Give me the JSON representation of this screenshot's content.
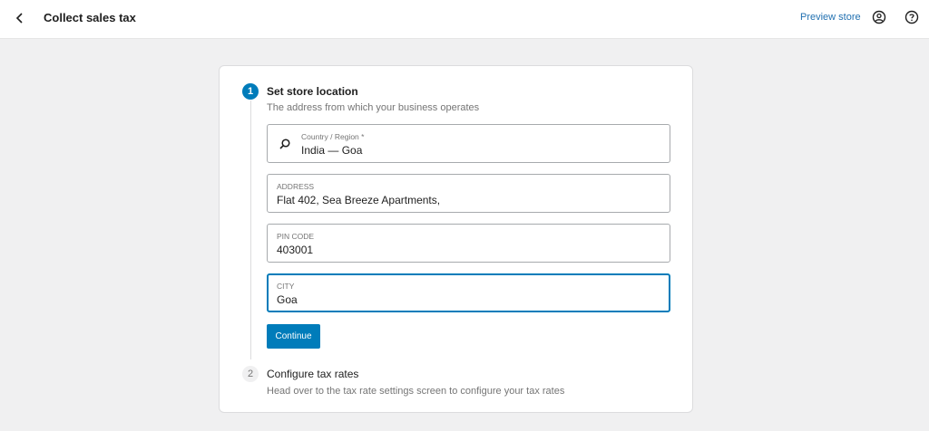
{
  "header": {
    "back_icon": "chevron-left-icon",
    "title": "Collect sales tax",
    "preview_label": "Preview store",
    "account_icon": "user-circle-icon",
    "help_icon": "help-circle-icon"
  },
  "steps": [
    {
      "number": "1",
      "title": "Set store location",
      "description": "The address from which your business operates",
      "state": "active",
      "fields": {
        "country": {
          "label": "Country / Region *",
          "value": "India — Goa",
          "icon": "search-icon"
        },
        "address": {
          "label": "ADDRESS",
          "value": "Flat 402, Sea Breeze Apartments,"
        },
        "pincode": {
          "label": "PIN CODE",
          "value": "403001"
        },
        "city": {
          "label": "CITY",
          "value": "Goa",
          "focused": true
        }
      },
      "continue_label": "Continue"
    },
    {
      "number": "2",
      "title": "Configure tax rates",
      "description": "Head over to the tax rate settings screen to configure your tax rates",
      "state": "pending"
    }
  ],
  "colors": {
    "accent": "#007cba",
    "link": "#2271b1",
    "background": "#f0f0f1"
  }
}
